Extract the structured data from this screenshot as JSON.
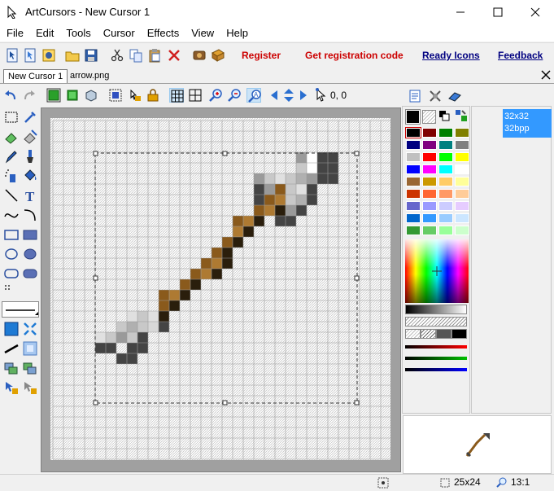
{
  "window": {
    "title": "ArtCursors - New Cursor 1",
    "minimize_icon": "minimize-icon",
    "maximize_icon": "maximize-icon",
    "close_icon": "close-icon"
  },
  "menu": [
    "File",
    "Edit",
    "Tools",
    "Cursor",
    "Effects",
    "View",
    "Help"
  ],
  "toolbar": {
    "links": {
      "register": "Register",
      "get_code": "Get registration code",
      "ready_icons": "Ready Icons",
      "feedback": "Feedback"
    },
    "link_color": "#cc0000",
    "icons": [
      "new-cursor-icon",
      "new-animated-icon",
      "open-resource-icon",
      "open-folder-icon",
      "save-icon",
      "cut-icon",
      "copy-icon",
      "paste-icon",
      "delete-icon",
      "scan-icon",
      "ready-icons-icon"
    ]
  },
  "tabs": [
    "New Cursor 1",
    "arrow.png"
  ],
  "editor": {
    "coords": "0, 0",
    "icons": [
      "undo-icon",
      "redo-icon",
      "green-cube-icon",
      "green-cube-2-icon",
      "3d-cube-icon",
      "select-all-icon",
      "hotspot-lock-icon",
      "grid-icon",
      "grid-2-icon",
      "zoom-in-icon",
      "zoom-out-icon",
      "text-zoom-icon",
      "move-left-icon",
      "move-vertical-icon",
      "move-right-icon",
      "hotspot-icon"
    ]
  },
  "tools": [
    "rect-select-icon",
    "eyedropper-icon",
    "eraser-icon",
    "color-replace-icon",
    "pencil-icon",
    "brush-icon",
    "spray-icon",
    "fill-icon",
    "line-icon",
    "text-icon",
    "curve-icon",
    "arc-icon",
    "rectangle-icon",
    "filled-rectangle-icon",
    "ellipse-icon",
    "filled-ellipse-icon",
    "rounded-rect-icon",
    "filled-rounded-rect-icon"
  ],
  "colors": {
    "primary": "#000000",
    "palette": [
      "#000000",
      "#800000",
      "#008000",
      "#808000",
      "#000080",
      "#800080",
      "#008080",
      "#808080",
      "#c0c0c0",
      "#ff0000",
      "#00ff00",
      "#ffff00",
      "#0000ff",
      "#ff00ff",
      "#00ffff",
      "#ffffff",
      "#996633",
      "#cc9900",
      "#ffcc66",
      "#ffff99",
      "#cc3300",
      "#ff6633",
      "#ff9966",
      "#ffcc99",
      "#6666cc",
      "#9999ff",
      "#ccccff",
      "#e6ccff",
      "#0066cc",
      "#3399ff",
      "#99ccff",
      "#cce6ff",
      "#339933",
      "#66cc66",
      "#99ff99",
      "#ccffcc"
    ]
  },
  "formats": {
    "line1": "32x32",
    "line2": "32bpp"
  },
  "status": {
    "size": "25x24",
    "zoom": "13:1"
  },
  "cursor_pixels": {
    "grid": [
      32,
      32
    ],
    "cells": [
      [
        23,
        3,
        "#9a9a9a"
      ],
      [
        24,
        3,
        "#ffffff"
      ],
      [
        25,
        3,
        "#444444"
      ],
      [
        26,
        3,
        "#444444"
      ],
      [
        23,
        4,
        "#c8c8c8"
      ],
      [
        24,
        4,
        "#ffffff"
      ],
      [
        25,
        4,
        "#444444"
      ],
      [
        26,
        4,
        "#444444"
      ],
      [
        19,
        5,
        "#9a9a9a"
      ],
      [
        20,
        5,
        "#c8c8c8"
      ],
      [
        21,
        5,
        "#e0e0e0"
      ],
      [
        22,
        5,
        "#c8c8c8"
      ],
      [
        23,
        5,
        "#b0b0b0"
      ],
      [
        24,
        5,
        "#9a9a9a"
      ],
      [
        25,
        5,
        "#444444"
      ],
      [
        26,
        5,
        "#444444"
      ],
      [
        19,
        6,
        "#444444"
      ],
      [
        20,
        6,
        "#9a9a9a"
      ],
      [
        21,
        6,
        "#8a5a1c"
      ],
      [
        22,
        6,
        "#c8c8c8"
      ],
      [
        23,
        6,
        "#e0e0e0"
      ],
      [
        24,
        6,
        "#444444"
      ],
      [
        19,
        7,
        "#444444"
      ],
      [
        20,
        7,
        "#8a5a1c"
      ],
      [
        21,
        7,
        "#ae7a32"
      ],
      [
        22,
        7,
        "#c8c8c8"
      ],
      [
        23,
        7,
        "#b0b0b0"
      ],
      [
        24,
        7,
        "#444444"
      ],
      [
        19,
        8,
        "#8a5a1c"
      ],
      [
        20,
        8,
        "#ae7a32"
      ],
      [
        21,
        8,
        "#2a1e0c"
      ],
      [
        22,
        8,
        "#9a9a9a"
      ],
      [
        23,
        8,
        "#444444"
      ],
      [
        17,
        9,
        "#8a5a1c"
      ],
      [
        18,
        9,
        "#ae7a32"
      ],
      [
        19,
        9,
        "#2a1e0c"
      ],
      [
        21,
        9,
        "#444444"
      ],
      [
        22,
        9,
        "#444444"
      ],
      [
        17,
        10,
        "#ae7a32"
      ],
      [
        18,
        10,
        "#2a1e0c"
      ],
      [
        16,
        11,
        "#8a5a1c"
      ],
      [
        17,
        11,
        "#2a1e0c"
      ],
      [
        15,
        12,
        "#8a5a1c"
      ],
      [
        16,
        12,
        "#2a1e0c"
      ],
      [
        14,
        13,
        "#8a5a1c"
      ],
      [
        15,
        13,
        "#ae7a32"
      ],
      [
        16,
        13,
        "#2a1e0c"
      ],
      [
        13,
        14,
        "#8a5a1c"
      ],
      [
        14,
        14,
        "#ae7a32"
      ],
      [
        15,
        14,
        "#2a1e0c"
      ],
      [
        12,
        15,
        "#8a5a1c"
      ],
      [
        13,
        15,
        "#2a1e0c"
      ],
      [
        10,
        16,
        "#8a5a1c"
      ],
      [
        11,
        16,
        "#ae7a32"
      ],
      [
        12,
        16,
        "#2a1e0c"
      ],
      [
        10,
        17,
        "#8a5a1c"
      ],
      [
        11,
        17,
        "#2a1e0c"
      ],
      [
        7,
        18,
        "#e0e0e0"
      ],
      [
        8,
        18,
        "#c8c8c8"
      ],
      [
        9,
        18,
        "#e0e0e0"
      ],
      [
        10,
        18,
        "#2a1e0c"
      ],
      [
        6,
        19,
        "#c8c8c8"
      ],
      [
        7,
        19,
        "#b0b0b0"
      ],
      [
        8,
        19,
        "#c8c8c8"
      ],
      [
        9,
        19,
        "#d8d8d8"
      ],
      [
        10,
        19,
        "#444444"
      ],
      [
        4,
        20,
        "#e0e0e0"
      ],
      [
        5,
        20,
        "#c8c8c8"
      ],
      [
        6,
        20,
        "#9a9a9a"
      ],
      [
        7,
        20,
        "#c8c8c8"
      ],
      [
        8,
        20,
        "#444444"
      ],
      [
        4,
        21,
        "#444444"
      ],
      [
        5,
        21,
        "#444444"
      ],
      [
        7,
        21,
        "#444444"
      ],
      [
        8,
        21,
        "#444444"
      ],
      [
        6,
        22,
        "#444444"
      ],
      [
        7,
        22,
        "#444444"
      ]
    ]
  }
}
